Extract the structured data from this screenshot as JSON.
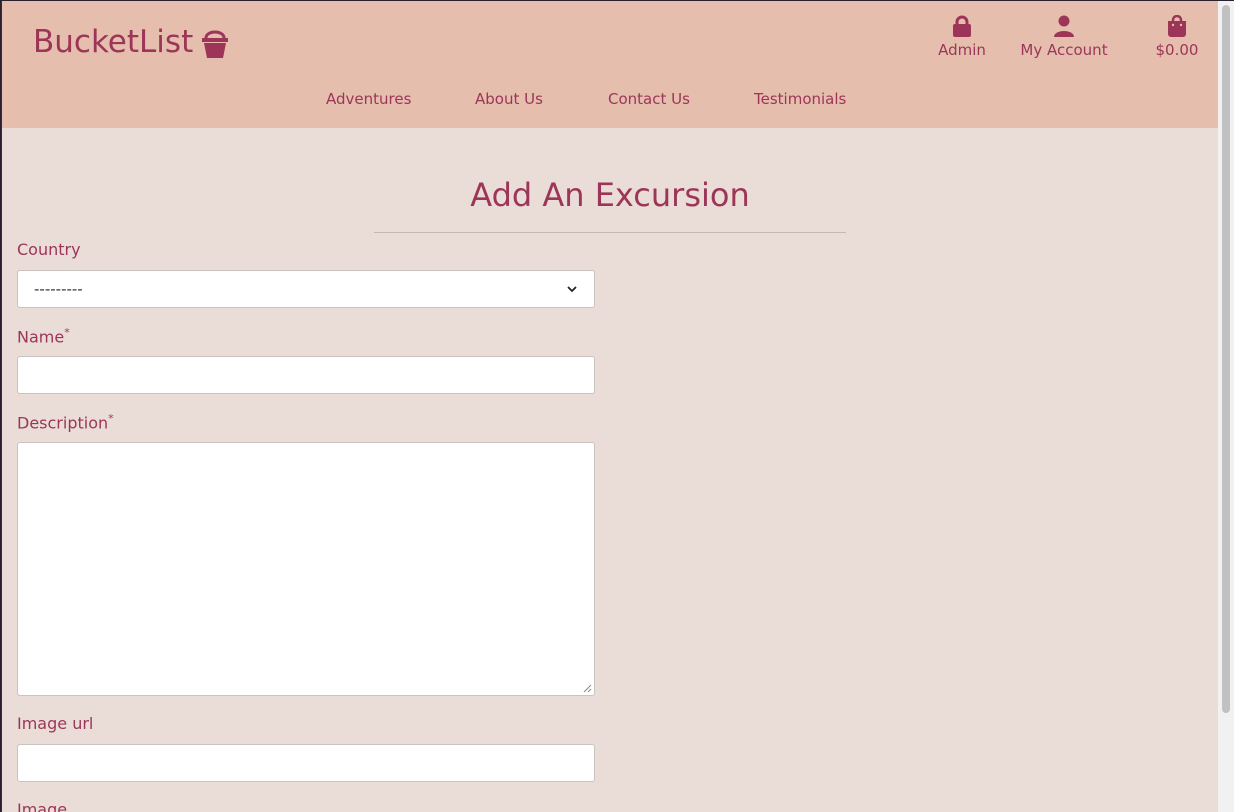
{
  "header": {
    "logo_text": "BucketList",
    "top_links": [
      {
        "label": "Admin",
        "icon": "lock-icon"
      },
      {
        "label": "My Account",
        "icon": "user-icon"
      },
      {
        "label": "$0.00",
        "icon": "shopping-bag-icon"
      }
    ],
    "nav": [
      "Adventures",
      "About Us",
      "Contact Us",
      "Testimonials"
    ]
  },
  "form": {
    "title": "Add An Excursion",
    "fields": {
      "country": {
        "label": "Country",
        "value": "---------"
      },
      "name": {
        "label": "Name",
        "required_mark": "*",
        "value": ""
      },
      "description": {
        "label": "Description",
        "required_mark": "*",
        "value": ""
      },
      "image_url": {
        "label": "Image url",
        "value": ""
      },
      "image": {
        "label": "Image"
      }
    }
  },
  "colors": {
    "header_bg": "#e5beae",
    "page_bg": "#eaddd7",
    "accent": "#9c3558"
  }
}
